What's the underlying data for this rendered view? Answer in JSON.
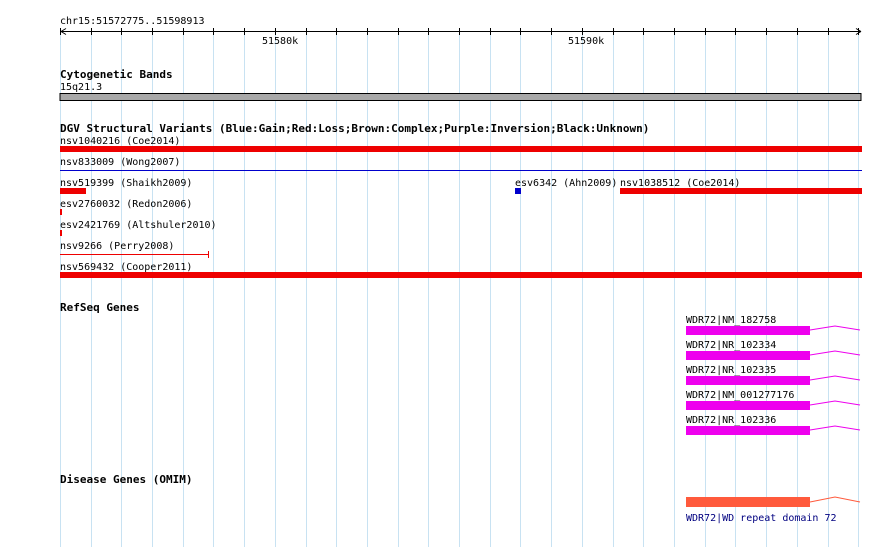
{
  "ruler": {
    "location": "chr15:51572775..51598913",
    "tick_labels": [
      "51580k",
      "51590k"
    ]
  },
  "tracks": {
    "cytoband": {
      "title": "Cytogenetic Bands",
      "band_label": "15q21.3"
    },
    "dgv": {
      "title": "DGV Structural Variants (Blue:Gain;Red:Loss;Brown:Complex;Purple:Inversion;Black:Unknown)",
      "features": [
        {
          "label": "nsv1040216 (Coe2014)",
          "color": "#ee0000"
        },
        {
          "label": "nsv833009 (Wong2007)",
          "color": "#0000cc"
        },
        {
          "label": "nsv519399 (Shaikh2009)",
          "color": "#ee0000"
        },
        {
          "label": "esv6342 (Ahn2009)",
          "color": "#0000cc"
        },
        {
          "label": "nsv1038512 (Coe2014)",
          "color": "#ee0000"
        },
        {
          "label": "esv2760032 (Redon2006)",
          "color": "#ee0000"
        },
        {
          "label": "esv2421769 (Altshuler2010)",
          "color": "#ee0000"
        },
        {
          "label": "nsv9266 (Perry2008)",
          "color": "#ee0000"
        },
        {
          "label": "nsv569432 (Cooper2011)",
          "color": "#ee0000"
        }
      ]
    },
    "refseq": {
      "title": "RefSeq Genes",
      "color": "#ee00ee",
      "genes": [
        {
          "label": "WDR72|NM_182758"
        },
        {
          "label": "WDR72|NR_102334"
        },
        {
          "label": "WDR72|NR_102335"
        },
        {
          "label": "WDR72|NM_001277176"
        },
        {
          "label": "WDR72|NR_102336"
        }
      ]
    },
    "omim": {
      "title": "Disease Genes (OMIM)",
      "color": "#ff5a3c",
      "gene_label": "WDR72|WD repeat domain 72"
    }
  }
}
